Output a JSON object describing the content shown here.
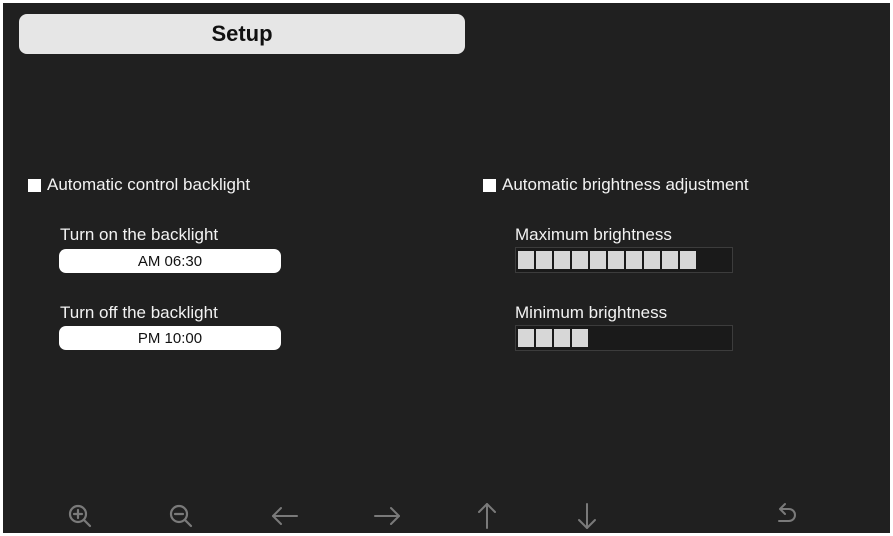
{
  "header": {
    "title": "Setup"
  },
  "backlight": {
    "auto_label": "Automatic control backlight",
    "auto_checked": true,
    "on_label": "Turn on the backlight",
    "on_value": "AM 06:30",
    "off_label": "Turn off the backlight",
    "off_value": "PM 10:00"
  },
  "brightness": {
    "auto_label": "Automatic brightness adjustment",
    "auto_checked": true,
    "max_label": "Maximum brightness",
    "max_level": 10,
    "min_label": "Minimum brightness",
    "min_level": 4
  },
  "toolbar": {
    "icons": [
      "zoom-in-icon",
      "zoom-out-icon",
      "arrow-left-icon",
      "arrow-right-icon",
      "arrow-up-icon",
      "arrow-down-icon",
      "return-icon"
    ]
  },
  "colors": {
    "background": "#202020",
    "text": "#f2f2f2",
    "bar_fill": "#d7d7d7",
    "icon": "#7a7a7a"
  }
}
